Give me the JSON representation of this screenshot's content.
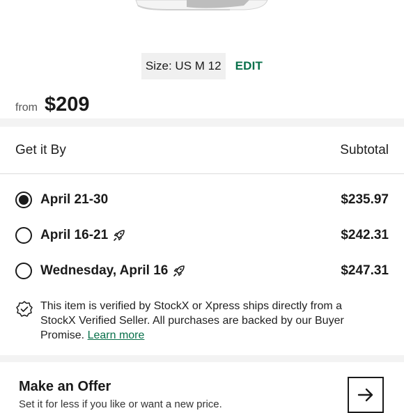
{
  "product": {
    "image_icon": "sneaker-image"
  },
  "size": {
    "label": "Size: US M 12",
    "edit_label": "EDIT"
  },
  "price": {
    "from_label": "from",
    "amount": "$209"
  },
  "delivery": {
    "header_left": "Get it By",
    "header_right": "Subtotal",
    "options": [
      {
        "label": "April 21-30",
        "price": "$235.97",
        "selected": true,
        "icon": null
      },
      {
        "label": "April 16-21",
        "price": "$242.31",
        "selected": false,
        "icon": "rocket-icon"
      },
      {
        "label": "Wednesday, April 16",
        "price": "$247.31",
        "selected": false,
        "icon": "rocket-icon"
      }
    ]
  },
  "verification": {
    "icon": "verified-badge-icon",
    "text": "This item is verified by StockX or Xpress ships directly from a StockX Verified Seller. All purchases are backed by our Buyer Promise. ",
    "link_label": "Learn more"
  },
  "offer": {
    "title": "Make an Offer",
    "subtitle": "Set it for less if you like or want a new price.",
    "icon": "arrow-right-icon"
  },
  "colors": {
    "accent_green": "#08704a",
    "text": "#1a1a1a",
    "band_gray": "#f3f3f3"
  }
}
